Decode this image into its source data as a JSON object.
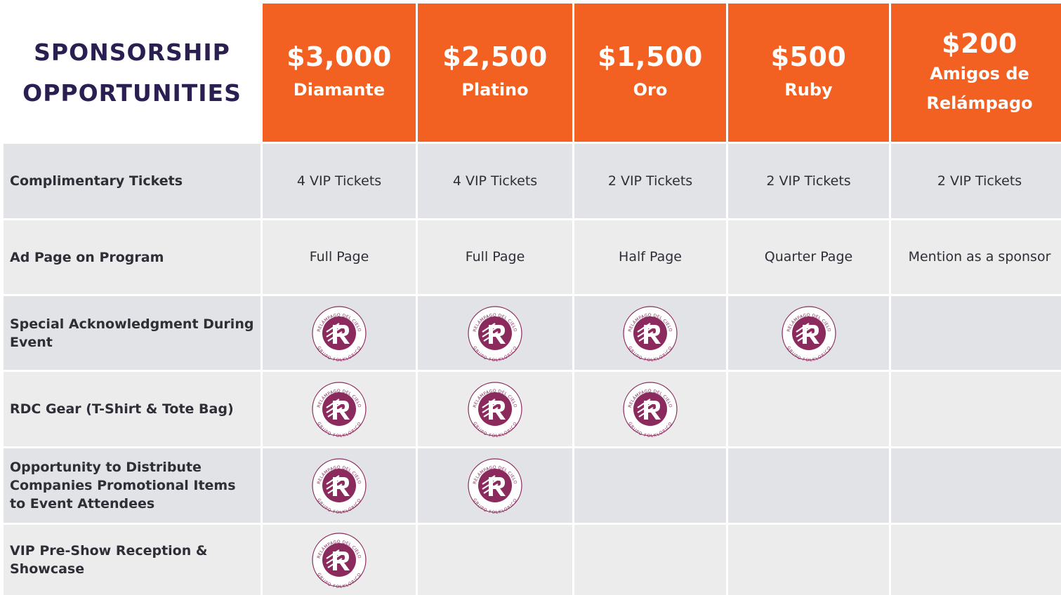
{
  "title": {
    "line1": "SPONSORSHIP",
    "line2": "OPPORTUNITIES"
  },
  "tiers": [
    {
      "price": "$3,000",
      "name": "Diamante"
    },
    {
      "price": "$2,500",
      "name": "Platino"
    },
    {
      "price": "$1,500",
      "name": "Oro"
    },
    {
      "price": "$500",
      "name": "Ruby"
    },
    {
      "price": "$200",
      "name": "Amigos de Relámpago"
    }
  ],
  "rows": [
    {
      "label": "Complimentary Tickets",
      "cells": [
        "4 VIP Tickets",
        "4 VIP Tickets",
        "2 VIP Tickets",
        "2 VIP Tickets",
        "2 VIP Tickets"
      ]
    },
    {
      "label": "Ad Page on Program",
      "cells": [
        "Full Page",
        "Full Page",
        "Half Page",
        "Quarter Page",
        "Mention as a sponsor"
      ]
    },
    {
      "label": "Special Acknowledgment During Event",
      "included": [
        true,
        true,
        true,
        true,
        false
      ]
    },
    {
      "label": "RDC Gear (T-Shirt & Tote Bag)",
      "included": [
        true,
        true,
        true,
        false,
        false
      ]
    },
    {
      "label": "Opportunity to Distribute Companies Promotional Items to Event Attendees",
      "included": [
        true,
        true,
        false,
        false,
        false
      ]
    },
    {
      "label": "VIP Pre-Show Reception & Showcase",
      "included": [
        true,
        false,
        false,
        false,
        false
      ]
    }
  ],
  "logo": {
    "icon": "relampago-del-cielo-logo",
    "top_text": "RELÁMPAGO DEL CIELO",
    "bottom_text": "GRUPO FOLKLÓRICO"
  },
  "colors": {
    "header_orange": "#f26022",
    "title_navy": "#2b1f52",
    "logo_magenta": "#8b2a5c",
    "row_gray_dark": "#e2e3e6",
    "row_gray_light": "#ececed"
  }
}
